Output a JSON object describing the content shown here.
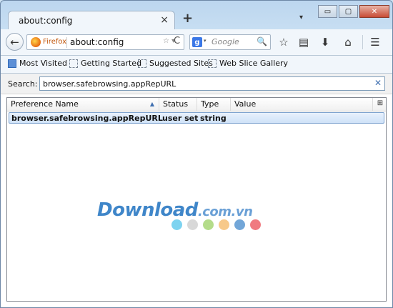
{
  "window": {
    "tab_title": "about:config",
    "tab_close": "×",
    "new_tab": "+",
    "tabs_dropdown": "▾",
    "controls": {
      "minimize": "▭",
      "maximize": "▢",
      "close": "✕"
    }
  },
  "navbar": {
    "back": "←",
    "identity_label": "Firefox",
    "url": "about:config",
    "url_star_dropdown": "☆ ▾",
    "reload": "C",
    "search_engine_icon": "g",
    "search_engine_dropdown": "▾",
    "search_placeholder": "Google",
    "search_go": "🔍",
    "icons": {
      "bookmark_star": "☆",
      "reading_list": "▤",
      "downloads": "⬇",
      "home": "⌂",
      "menu": "☰"
    }
  },
  "bookmarks": {
    "items": [
      {
        "label": "Most Visited",
        "icon": "most-visited-icon"
      },
      {
        "label": "Getting Started",
        "icon": "page-icon"
      },
      {
        "label": "Suggested Sites",
        "icon": "page-icon"
      },
      {
        "label": "Web Slice Gallery",
        "icon": "page-icon"
      }
    ]
  },
  "config": {
    "search_label": "Search:",
    "search_value": "browser.safebrowsing.appRepURL",
    "clear": "✕",
    "columns": [
      "Preference Name",
      "Status",
      "Type",
      "Value"
    ],
    "sort_indicator": "▲",
    "column_picker": "⊞",
    "rows": [
      {
        "name": "browser.safebrowsing.appRepURL",
        "status": "user set",
        "type": "string",
        "value": ""
      }
    ]
  },
  "watermark": {
    "text": "Download",
    "domain": ".com.vn",
    "dot_colors": [
      "#7dd3f0",
      "#d8d8d8",
      "#b4dc8a",
      "#f7c98a",
      "#72a6d8",
      "#f07a80"
    ]
  }
}
